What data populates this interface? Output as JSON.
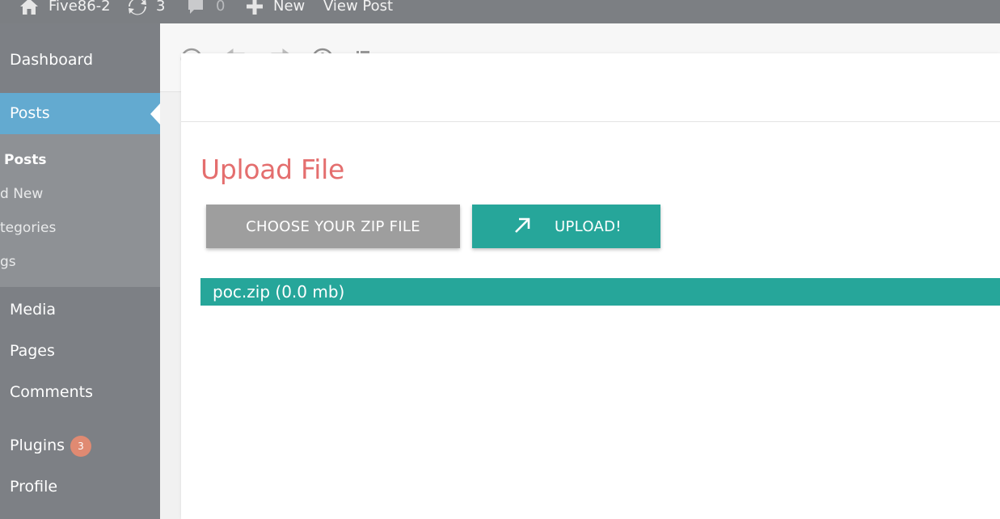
{
  "adminbar": {
    "site_name": "Five86-2",
    "updates_count": "3",
    "comments_count": "0",
    "new_label": "New",
    "view_post_label": "View Post"
  },
  "sidebar": {
    "dashboard": "Dashboard",
    "posts": "Posts",
    "submenu": {
      "all_posts": "Posts",
      "add_new": "d New",
      "categories": "tegories",
      "tags": "gs"
    },
    "media": "Media",
    "pages": "Pages",
    "comments": "Comments",
    "plugins": "Plugins",
    "plugins_badge": "3",
    "profile": "Profile"
  },
  "modal": {
    "title": "Upload File",
    "choose_button": "CHOOSE YOUR ZIP FILE",
    "upload_button": "UPLOAD!",
    "file_entry": "poc.zip (0.0 mb)"
  },
  "colors": {
    "admin_bar": "#7c7f83",
    "sidebar": "#7d8085",
    "active_menu": "#63aad0",
    "title": "#e46e6e",
    "teal": "#26a69a",
    "grey_button": "#9e9e9e",
    "badge": "#e08a72"
  },
  "icons": {
    "home": "home-icon",
    "updates": "updates-icon",
    "comments": "comment-icon",
    "new": "plus-icon",
    "upload": "arrow-up-right-icon"
  }
}
